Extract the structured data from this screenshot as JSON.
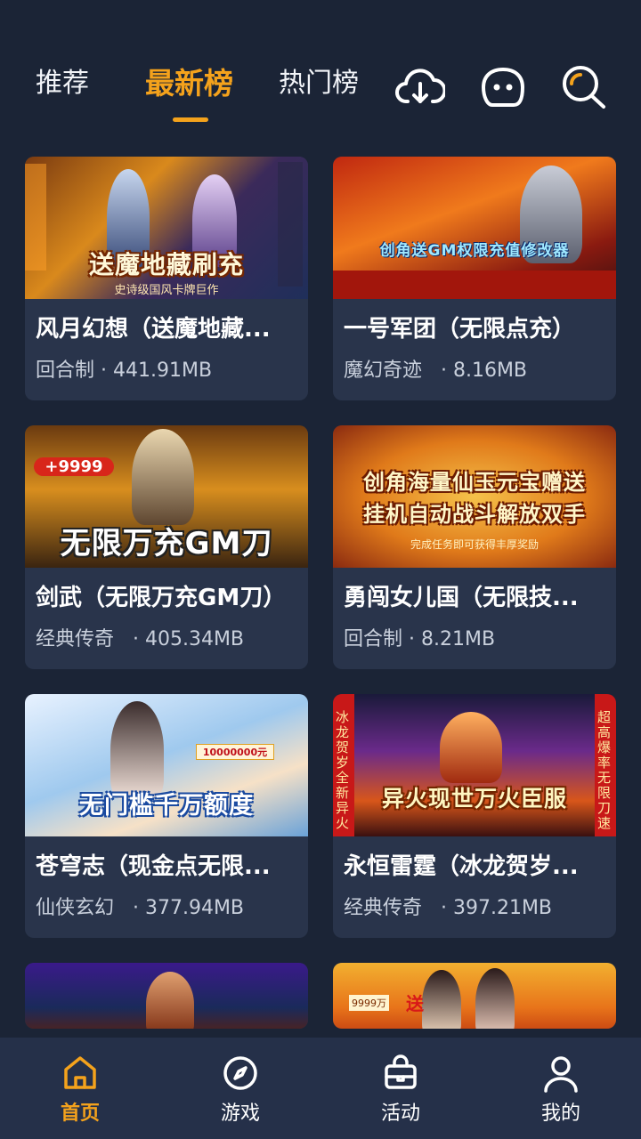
{
  "top_tabs": [
    {
      "label": "推荐",
      "active": false
    },
    {
      "label": "最新榜",
      "active": true
    },
    {
      "label": "热门榜",
      "active": false
    }
  ],
  "top_icons": [
    "cloud-download-icon",
    "message-icon",
    "search-icon"
  ],
  "colors": {
    "background": "#1b2436",
    "card": "#29344b",
    "accent": "#f4a21c",
    "nav": "#253049"
  },
  "games": [
    {
      "title": "风月幻想（送魔地藏...",
      "meta": "回合制 · 441.91MB",
      "banner_text": "送魔地藏刷充",
      "banner_sub": "史诗级国风卡牌巨作"
    },
    {
      "title": "一号军团（无限点充）",
      "meta": "魔幻奇迹   · 8.16MB",
      "banner_text": "创角送GM权限充值修改器",
      "banner_sub": ""
    },
    {
      "title": "剑武（无限万充GM刀）",
      "meta": "经典传奇   · 405.34MB",
      "banner_text": "无限万充GM刀",
      "banner_sub": "+9999"
    },
    {
      "title": "勇闯女儿国（无限技...",
      "meta": "回合制 · 8.21MB",
      "banner_text": "创角海量仙玉元宝赠送",
      "banner_text2": "挂机自动战斗解放双手",
      "banner_sub": "完成任务即可获得丰厚奖励"
    },
    {
      "title": "苍穹志（现金点无限...",
      "meta": "仙侠玄幻   · 377.94MB",
      "banner_text": "无门槛千万额度",
      "banner_sub": "10000000元"
    },
    {
      "title": "永恒雷霆（冰龙贺岁...",
      "meta": "经典传奇   · 397.21MB",
      "banner_text": "异火现世万火臣服",
      "banner_side_left": "冰龙贺岁全新异火",
      "banner_side_right": "超高爆率无限刀速"
    },
    {
      "title": "",
      "meta": "",
      "banner_text": ""
    },
    {
      "title": "",
      "meta": "",
      "banner_text": "",
      "banner_sub": "9999万",
      "banner_badge": "送"
    }
  ],
  "bottom_nav": [
    {
      "label": "首页",
      "icon": "home-icon",
      "active": true
    },
    {
      "label": "游戏",
      "icon": "compass-icon",
      "active": false
    },
    {
      "label": "活动",
      "icon": "gift-bag-icon",
      "active": false
    },
    {
      "label": "我的",
      "icon": "user-icon",
      "active": false
    }
  ]
}
